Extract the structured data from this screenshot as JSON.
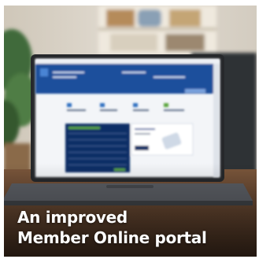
{
  "caption": {
    "line1": "An improved",
    "line2": "Member Online portal"
  },
  "colors": {
    "portal_header": "#1f4f9c",
    "portal_panel": "#0e2f66",
    "accent_green": "#5aa53c",
    "laptop_body": "#5a5d63",
    "wall": "#d9d2c6",
    "desk": "#6b4a33",
    "plant": "#3f6b3a"
  },
  "icons": [
    "laptop-icon",
    "plant-icon",
    "shelf-icon"
  ]
}
